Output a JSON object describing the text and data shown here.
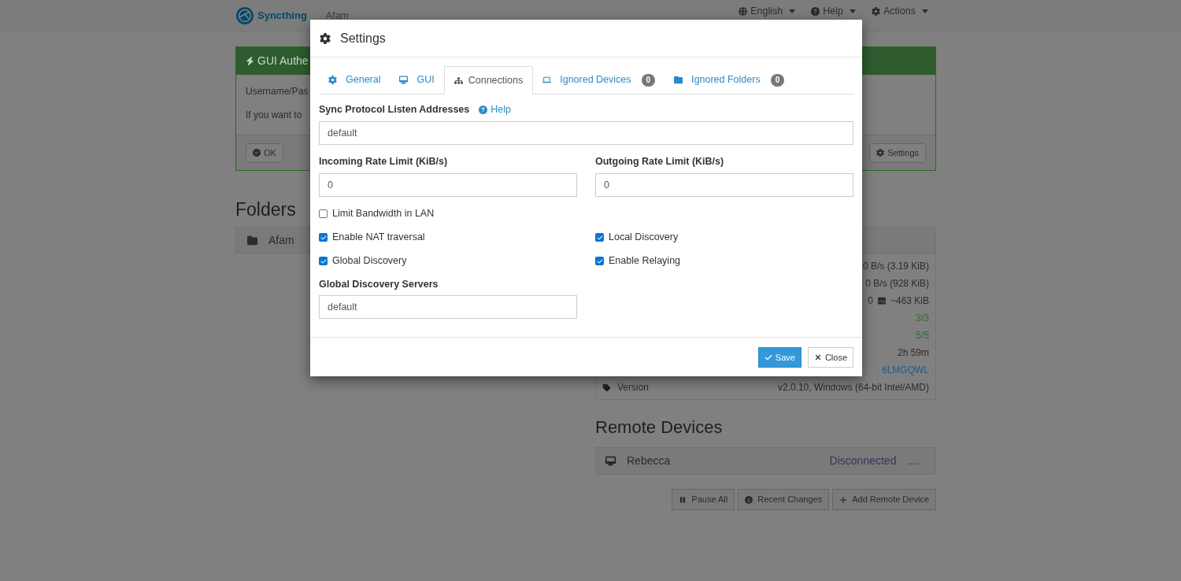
{
  "navbar": {
    "brand": "Syncthing",
    "device_name": "Afam",
    "menus": [
      {
        "label": "English"
      },
      {
        "label": "Help"
      },
      {
        "label": "Actions"
      }
    ]
  },
  "notice": {
    "title": "GUI Authe",
    "lines": [
      "Username/Pas",
      "If you want to"
    ],
    "buttons": [
      {
        "label": "OK"
      },
      {
        "label": "Settings"
      }
    ]
  },
  "folders": {
    "heading": "Folders",
    "items": [
      {
        "name": "Afam"
      }
    ]
  },
  "this_device": {
    "rows": [
      {
        "value": "0 B/s (3.19 KiB)",
        "color": "#2b2b2b"
      },
      {
        "value": "0 B/s (928 KiB)",
        "color": "#2b2b2b"
      },
      {
        "value": "0",
        "extra": "~463 KiB",
        "color": "#2b2b2b"
      },
      {
        "value": "3/3",
        "color": "#2e6e2e"
      },
      {
        "value": "5/5",
        "color": "#2e6e2e"
      },
      {
        "value": "2h 59m",
        "color": "#2b2b2b"
      },
      {
        "value": "6LMGQWL",
        "color": "#1d5a85"
      },
      {
        "label": "Version",
        "value": "v2.0.10, Windows (64-bit Intel/AMD)",
        "color": "#2b2b2b"
      }
    ]
  },
  "remote_devices": {
    "heading": "Remote Devices",
    "items": [
      {
        "name": "Rebecca",
        "status": "Disconnected",
        "menu": "...."
      }
    ],
    "buttons": [
      {
        "label": "Pause All"
      },
      {
        "label": "Recent Changes"
      },
      {
        "label": "Add Remote Device"
      }
    ]
  },
  "dialog": {
    "title": "Settings",
    "tabs": [
      {
        "label": "General",
        "selected": false
      },
      {
        "label": "GUI",
        "selected": false
      },
      {
        "label": "Connections",
        "selected": true
      },
      {
        "label": "Ignored Devices",
        "badge": "0",
        "selected": false
      },
      {
        "label": "Ignored Folders",
        "badge": "0",
        "selected": false
      }
    ],
    "listen": {
      "label": "Sync Protocol Listen Addresses",
      "help": "Help",
      "value": "default"
    },
    "incoming": {
      "label": "Incoming Rate Limit (KiB/s)",
      "value": "0"
    },
    "outgoing": {
      "label": "Outgoing Rate Limit (KiB/s)",
      "value": "0"
    },
    "checkbox_rows": [
      {
        "items": [
          {
            "label": "Limit Bandwidth in LAN",
            "checked": false
          }
        ]
      },
      {
        "items": [
          {
            "label": "Enable NAT traversal",
            "checked": true
          },
          {
            "label": "Local Discovery",
            "checked": true
          }
        ]
      },
      {
        "items": [
          {
            "label": "Global Discovery",
            "checked": true
          },
          {
            "label": "Enable Relaying",
            "checked": true
          }
        ]
      }
    ],
    "discovery_servers": {
      "label": "Global Discovery Servers",
      "value": "default"
    },
    "buttons": [
      {
        "label": "Save",
        "kind": "primary"
      },
      {
        "label": "Close",
        "kind": "default"
      }
    ]
  }
}
